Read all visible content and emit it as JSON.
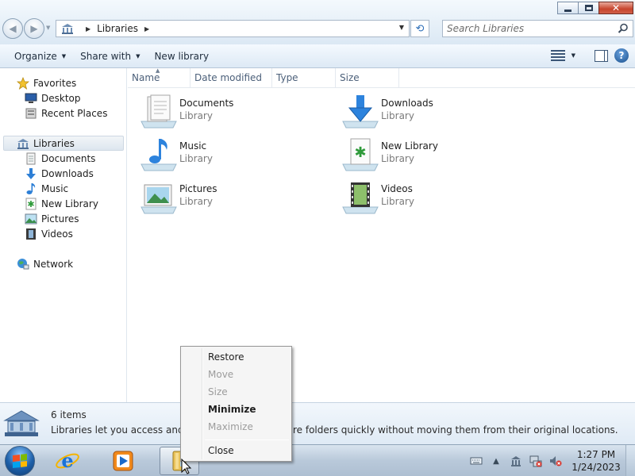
{
  "window": {
    "address": {
      "crumb": "Libraries"
    },
    "search": {
      "placeholder": "Search Libraries"
    },
    "caption_icons": [
      "minimize-icon",
      "restore-icon",
      "close-icon"
    ]
  },
  "toolbar": {
    "organize_label": "Organize",
    "share_label": "Share with",
    "new_library_label": "New library"
  },
  "sidebar": {
    "favorites": {
      "label": "Favorites",
      "items": [
        {
          "label": "Desktop"
        },
        {
          "label": "Recent Places"
        }
      ]
    },
    "libraries": {
      "label": "Libraries",
      "items": [
        {
          "label": "Documents"
        },
        {
          "label": "Downloads"
        },
        {
          "label": "Music"
        },
        {
          "label": "New Library"
        },
        {
          "label": "Pictures"
        },
        {
          "label": "Videos"
        }
      ]
    },
    "network": {
      "label": "Network"
    }
  },
  "columns": [
    "Name",
    "Date modified",
    "Type",
    "Size"
  ],
  "tiles": [
    {
      "name": "Documents",
      "subtitle": "Library",
      "icon": "documents-library-icon"
    },
    {
      "name": "Downloads",
      "subtitle": "Library",
      "icon": "downloads-library-icon"
    },
    {
      "name": "Music",
      "subtitle": "Library",
      "icon": "music-library-icon"
    },
    {
      "name": "New Library",
      "subtitle": "Library",
      "icon": "new-library-icon"
    },
    {
      "name": "Pictures",
      "subtitle": "Library",
      "icon": "pictures-library-icon"
    },
    {
      "name": "Videos",
      "subtitle": "Library",
      "icon": "videos-library-icon"
    }
  ],
  "details": {
    "count": "6 items",
    "description": "Libraries let you access and arra",
    "description_tail": "re folders quickly without moving them from their original locations."
  },
  "context_menu": {
    "items": [
      {
        "label": "Restore",
        "state": "enabled"
      },
      {
        "label": "Move",
        "state": "disabled"
      },
      {
        "label": "Size",
        "state": "disabled"
      },
      {
        "label": "Minimize",
        "state": "default"
      },
      {
        "label": "Maximize",
        "state": "disabled"
      },
      {
        "label": "Close",
        "state": "enabled"
      }
    ]
  },
  "taskbar": {
    "apps": [
      "internet-explorer-icon",
      "media-player-icon",
      "explorer-icon"
    ],
    "clock": {
      "time": "1:27 PM",
      "date": "1/24/2023"
    }
  },
  "colors": {
    "accent": "#1d5fa8",
    "toolbar_bg": "#dde9f5",
    "selection": "#dde6ef"
  }
}
